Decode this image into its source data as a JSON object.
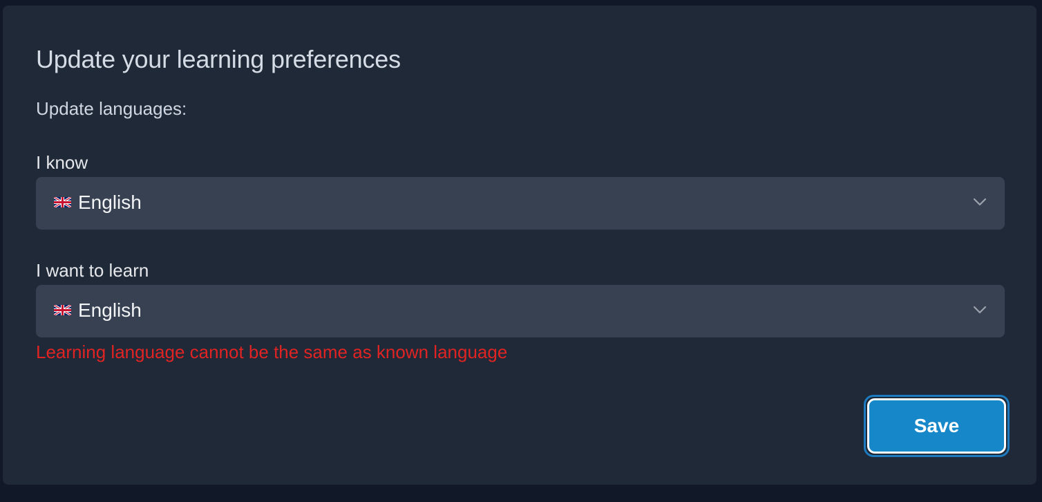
{
  "form": {
    "title": "Update your learning preferences",
    "subtitle": "Update languages:",
    "known": {
      "label": "I know",
      "selected": "English",
      "flag_icon": "uk-flag-icon"
    },
    "learn": {
      "label": "I want to learn",
      "selected": "English",
      "flag_icon": "uk-flag-icon"
    },
    "error_message": "Learning language cannot be the same as known language",
    "save_label": "Save"
  },
  "colors": {
    "page_background": "#111827",
    "card_background": "#1f2937",
    "select_background": "#374151",
    "error": "#e02424",
    "accent": "#1687c9"
  }
}
